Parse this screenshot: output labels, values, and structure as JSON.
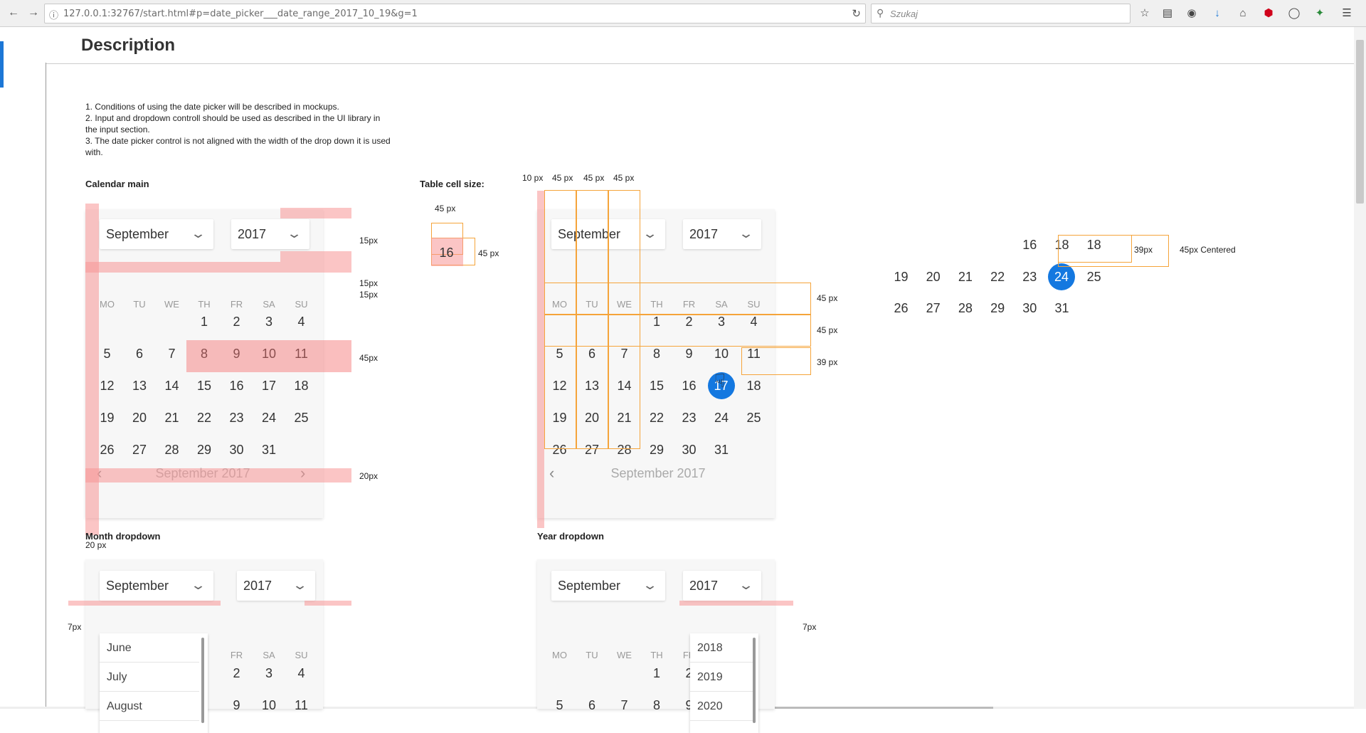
{
  "browser": {
    "url": "127.0.0.1:32767/start.html#p=date_picker___date_range_2017_10_19&g=1",
    "search_placeholder": "Szukaj"
  },
  "page": {
    "title": "Description",
    "notes": [
      "1. Conditions of using the date picker will be described in mockups.",
      "2. Input and dropdown controll should be used as described in the UI library in the input section.",
      "3. The date picker control is not aligned with the width of the drop down it is used with."
    ]
  },
  "captions": {
    "calendar_main": "Calendar main",
    "table_cell_size": "Table cell size:",
    "month_dropdown": "Month dropdown",
    "year_dropdown": "Year dropdown"
  },
  "measurements": {
    "m15a": "15px",
    "m15b": "15px",
    "m15c": "15px",
    "m45": "45px",
    "m20": "20px",
    "m20b": "20 px",
    "cell_w": "45 px",
    "cell_h": "45 px",
    "col10": "10 px",
    "col45a": "45 px",
    "col45b": "45 px",
    "col45c": "45 px",
    "row1": "45 px",
    "row2": "45 px",
    "row3": "39 px",
    "range39": "39px",
    "range45c": "45px Centered",
    "m7a": "7px",
    "m7b": "7px"
  },
  "calendar": {
    "month": "September",
    "year": "2017",
    "weekdays": [
      "MO",
      "TU",
      "WE",
      "TH",
      "FR",
      "SA",
      "SU"
    ],
    "footer": "September 2017",
    "weeks": [
      [
        "",
        "",
        "",
        "1",
        "2",
        "3",
        "4"
      ],
      [
        "5",
        "6",
        "7",
        "8",
        "9",
        "10",
        "11"
      ],
      [
        "12",
        "13",
        "14",
        "15",
        "16",
        "17",
        "18"
      ],
      [
        "19",
        "20",
        "21",
        "22",
        "23",
        "24",
        "25"
      ],
      [
        "26",
        "27",
        "28",
        "29",
        "30",
        "31",
        ""
      ]
    ],
    "selected_day": "17",
    "cell_sample": "16"
  },
  "range_example": {
    "row1": [
      "16",
      "18",
      "18"
    ],
    "row2": [
      "19",
      "20",
      "21",
      "22",
      "23",
      "24",
      "25"
    ],
    "row3": [
      "26",
      "27",
      "28",
      "29",
      "30",
      "31"
    ],
    "selected": "24"
  },
  "month_dropdown": {
    "options": [
      "June",
      "July",
      "August"
    ],
    "partial_days_row1": [
      "2",
      "3",
      "4"
    ],
    "partial_days_row2": [
      "9",
      "10",
      "11"
    ],
    "partial_weekdays": [
      "FR",
      "SA",
      "SU"
    ]
  },
  "year_dropdown": {
    "options": [
      "2018",
      "2019",
      "2020"
    ],
    "partial_weekdays": [
      "MO",
      "TU",
      "WE",
      "TH",
      "FR"
    ],
    "partial_days_row1": [
      "1",
      "2"
    ],
    "partial_days_row2": [
      "5",
      "6",
      "7",
      "8",
      "9"
    ]
  },
  "colors": {
    "accent": "#1478e0",
    "guide_pink": "#f89696",
    "guide_orange": "#f5a43a"
  }
}
